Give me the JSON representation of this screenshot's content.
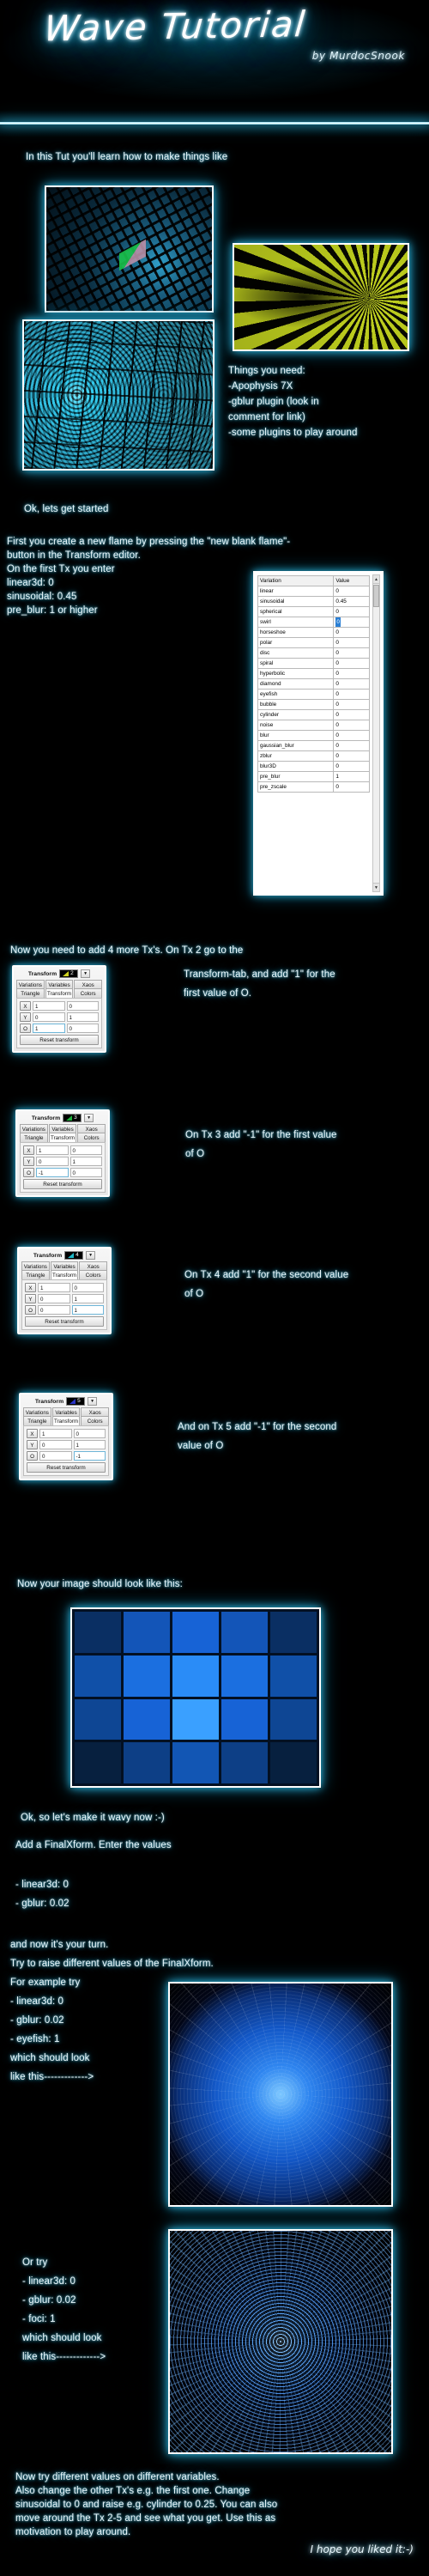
{
  "header": {
    "title": "Wave Tutorial",
    "byline": "by MurdocSnook"
  },
  "intro": {
    "line": "In this Tut you'll learn how to make things like"
  },
  "needs": {
    "heading": "Things you need:",
    "items": [
      "-Apophysis 7X",
      "-gblur plugin (look in",
      "comment for link)",
      "-some plugins to play around"
    ]
  },
  "start": {
    "ok_line": "Ok, lets get started",
    "p1_line1": "First you create a new flame by pressing the \"new blank flame\"-",
    "p1_line2": "button in the Transform editor.",
    "p1_line3": "On the first Tx you enter",
    "p1_line4": "linear3d: 0",
    "p1_line5": "sinusoidal: 0.45",
    "p1_line6": "pre_blur: 1 or higher"
  },
  "variations_panel": {
    "columns": [
      "Variation",
      "Value"
    ],
    "rows": [
      {
        "name": "linear",
        "value": "0",
        "selected": false
      },
      {
        "name": "sinusoidal",
        "value": "0.45",
        "selected": false
      },
      {
        "name": "spherical",
        "value": "0",
        "selected": false
      },
      {
        "name": "swirl",
        "value": "0",
        "selected": true
      },
      {
        "name": "horseshoe",
        "value": "0",
        "selected": false
      },
      {
        "name": "polar",
        "value": "0",
        "selected": false
      },
      {
        "name": "disc",
        "value": "0",
        "selected": false
      },
      {
        "name": "spiral",
        "value": "0",
        "selected": false
      },
      {
        "name": "hyperbolic",
        "value": "0",
        "selected": false
      },
      {
        "name": "diamond",
        "value": "0",
        "selected": false
      },
      {
        "name": "eyefish",
        "value": "0",
        "selected": false
      },
      {
        "name": "bubble",
        "value": "0",
        "selected": false
      },
      {
        "name": "cylinder",
        "value": "0",
        "selected": false
      },
      {
        "name": "noise",
        "value": "0",
        "selected": false
      },
      {
        "name": "blur",
        "value": "0",
        "selected": false
      },
      {
        "name": "gaussian_blur",
        "value": "0",
        "selected": false
      },
      {
        "name": "zblur",
        "value": "0",
        "selected": false
      },
      {
        "name": "blur3D",
        "value": "0",
        "selected": false
      },
      {
        "name": "pre_blur",
        "value": "1",
        "selected": false
      },
      {
        "name": "pre_zscale",
        "value": "0",
        "selected": false
      }
    ]
  },
  "tx_section": {
    "lead_line1": "Now you need to add 4 more Tx's. On Tx 2 go to the",
    "notes": [
      {
        "line1": "Transform-tab, and add \"1\" for the",
        "line2": "first value of O."
      },
      {
        "line1": "On Tx 3 add \"-1\" for the first value",
        "line2": "of O"
      },
      {
        "line1": "On Tx 4 add \"1\" for the second value",
        "line2": "of O"
      },
      {
        "line1": "And on Tx 5 add \"-1\" for the second",
        "line2": "value of O"
      }
    ],
    "dialogs": [
      {
        "title": "Transform",
        "index": "2",
        "swatch": "#cfd21f",
        "tabs_top": [
          "Variations",
          "Variables",
          "Xaos"
        ],
        "tabs_bottom": [
          "Triangle",
          "Transform",
          "Colors"
        ],
        "active_tab": "Transform",
        "fields": [
          {
            "label": "X",
            "a": "1",
            "b": "0",
            "focus": ""
          },
          {
            "label": "Y",
            "a": "0",
            "b": "1",
            "focus": ""
          },
          {
            "label": "O",
            "a": "1",
            "b": "0",
            "focus": "a"
          }
        ],
        "reset_label": "Reset transform"
      },
      {
        "title": "Transform",
        "index": "3",
        "swatch": "#1db03a",
        "tabs_top": [
          "Variations",
          "Variables",
          "Xaos"
        ],
        "tabs_bottom": [
          "Triangle",
          "Transform",
          "Colors"
        ],
        "active_tab": "Transform",
        "fields": [
          {
            "label": "X",
            "a": "1",
            "b": "0",
            "focus": ""
          },
          {
            "label": "Y",
            "a": "0",
            "b": "1",
            "focus": ""
          },
          {
            "label": "O",
            "a": "-1",
            "b": "0",
            "focus": "a"
          }
        ],
        "reset_label": "Reset transform"
      },
      {
        "title": "Transform",
        "index": "4",
        "swatch": "#1fb9c9",
        "tabs_top": [
          "Variations",
          "Variables",
          "Xaos"
        ],
        "tabs_bottom": [
          "Triangle",
          "Transform",
          "Colors"
        ],
        "active_tab": "Transform",
        "fields": [
          {
            "label": "X",
            "a": "1",
            "b": "0",
            "focus": ""
          },
          {
            "label": "Y",
            "a": "0",
            "b": "1",
            "focus": ""
          },
          {
            "label": "O",
            "a": "0",
            "b": "1",
            "focus": "b"
          }
        ],
        "reset_label": "Reset transform"
      },
      {
        "title": "Transform",
        "index": "5",
        "swatch": "#2a33c4",
        "tabs_top": [
          "Variations",
          "Variables",
          "Xaos"
        ],
        "tabs_bottom": [
          "Triangle",
          "Transform",
          "Colors"
        ],
        "active_tab": "Transform",
        "fields": [
          {
            "label": "X",
            "a": "1",
            "b": "0",
            "focus": ""
          },
          {
            "label": "Y",
            "a": "0",
            "b": "1",
            "focus": ""
          },
          {
            "label": "O",
            "a": "0",
            "b": "-1",
            "focus": "b"
          }
        ],
        "reset_label": "Reset transform"
      }
    ]
  },
  "result": {
    "caption": "Now your image should look like this:"
  },
  "wavy": {
    "ok_line": "Ok, so let's make it wavy now :-)",
    "add_line": "Add a FinalXform. Enter the values",
    "v1": "- linear3d: 0",
    "v2": "- gblur: 0.02"
  },
  "yourturn": {
    "line1": "and now it's your turn.",
    "line2": "Try to raise different values of the FinalXform.",
    "line3": "For example try",
    "v1": "- linear3d: 0",
    "v2": "- gblur: 0.02",
    "v3": "- eyefish: 1",
    "line4": "which should look",
    "line5": "like this------------->"
  },
  "ortry": {
    "line1": "Or try",
    "v1": "- linear3d: 0",
    "v2": "- gblur: 0.02",
    "v3": "- foci: 1",
    "line4": "which should look",
    "line5": "like this------------->"
  },
  "outro": {
    "line1": "Now try different values on different variables.",
    "line2": "Also change the other Tx's e.g. the first one. Change",
    "line3": "sinusoidal to 0 and raise e.g. cylinder to 0.25. You can also",
    "line4": "move around the Tx 2-5 and see what you get. Use this as",
    "line5": "motivation to play around.",
    "signature": "I hope you liked it:-)"
  },
  "colors": {
    "glow_cyan": "#2aa7cd",
    "text": "#e8f6fb",
    "background": "#000000"
  }
}
